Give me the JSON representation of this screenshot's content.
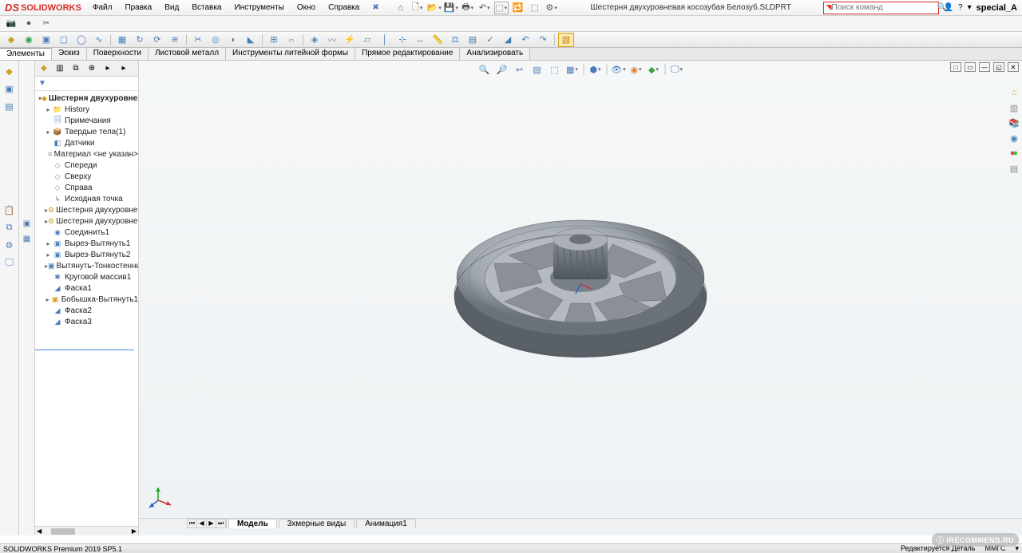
{
  "app": {
    "brand": "SOLIDWORKS"
  },
  "menu": [
    "Файл",
    "Правка",
    "Вид",
    "Вставка",
    "Инструменты",
    "Окно",
    "Справка"
  ],
  "document": {
    "name": "Шестерня двухуровневая косозубая Белозуб.SLDPRT"
  },
  "search": {
    "placeholder": "Поиск команд"
  },
  "user": {
    "name": "special_A",
    "help": "?"
  },
  "cmdTabs": [
    "Элементы",
    "Эскиз",
    "Поверхности",
    "Листовой металл",
    "Инструменты литейной формы",
    "Прямое редактирование",
    "Анализировать"
  ],
  "tree": {
    "root": "Шестерня двухуровневая косо",
    "items": [
      {
        "exp": "▸",
        "icon": "📁",
        "cls": "ti-gray",
        "label": "History"
      },
      {
        "exp": "",
        "icon": "🗐",
        "cls": "ti-blue",
        "label": "Примечания"
      },
      {
        "exp": "▸",
        "icon": "📦",
        "cls": "ti-blue",
        "label": "Твердые тела(1)"
      },
      {
        "exp": "",
        "icon": "◧",
        "cls": "ti-blue",
        "label": "Датчики"
      },
      {
        "exp": "",
        "icon": "≡",
        "cls": "ti-gray",
        "label": "Материал <не указан>"
      },
      {
        "exp": "",
        "icon": "◇",
        "cls": "ti-gray",
        "label": "Спереди"
      },
      {
        "exp": "",
        "icon": "◇",
        "cls": "ti-gray",
        "label": "Сверху"
      },
      {
        "exp": "",
        "icon": "◇",
        "cls": "ti-gray",
        "label": "Справа"
      },
      {
        "exp": "",
        "icon": "↳",
        "cls": "ti-gray",
        "label": "Исходная точка"
      },
      {
        "exp": "▸",
        "icon": "⚙",
        "cls": "ti-gold",
        "label": "Шестерня двухуровневая"
      },
      {
        "exp": "▸",
        "icon": "⚙",
        "cls": "ti-gold",
        "label": "Шестерня двухуровневая"
      },
      {
        "exp": "",
        "icon": "◉",
        "cls": "ti-blue",
        "label": "Соединить1"
      },
      {
        "exp": "▸",
        "icon": "▣",
        "cls": "ti-blue",
        "label": "Вырез-Вытянуть1"
      },
      {
        "exp": "▸",
        "icon": "▣",
        "cls": "ti-blue",
        "label": "Вырез-Вытянуть2"
      },
      {
        "exp": "▸",
        "icon": "▣",
        "cls": "ti-blue",
        "label": "Вытянуть-Тонкостенный"
      },
      {
        "exp": "",
        "icon": "✱",
        "cls": "ti-blue",
        "label": "Круговой массив1"
      },
      {
        "exp": "",
        "icon": "◢",
        "cls": "ti-blue",
        "label": "Фаска1"
      },
      {
        "exp": "▸",
        "icon": "▣",
        "cls": "ti-gold",
        "label": "Бобышка-Вытянуть1"
      },
      {
        "exp": "",
        "icon": "◢",
        "cls": "ti-blue",
        "label": "Фаска2"
      },
      {
        "exp": "",
        "icon": "◢",
        "cls": "ti-blue",
        "label": "Фаска3"
      }
    ]
  },
  "bottomTabs": [
    "Модель",
    "3хмерные виды",
    "Анимация1"
  ],
  "status": {
    "left": "SOLIDWORKS Premium 2019 SP5.1",
    "right1": "Редактируется Деталь",
    "right2": "ММГС"
  },
  "watermark": "IRECOMMEND.RU"
}
